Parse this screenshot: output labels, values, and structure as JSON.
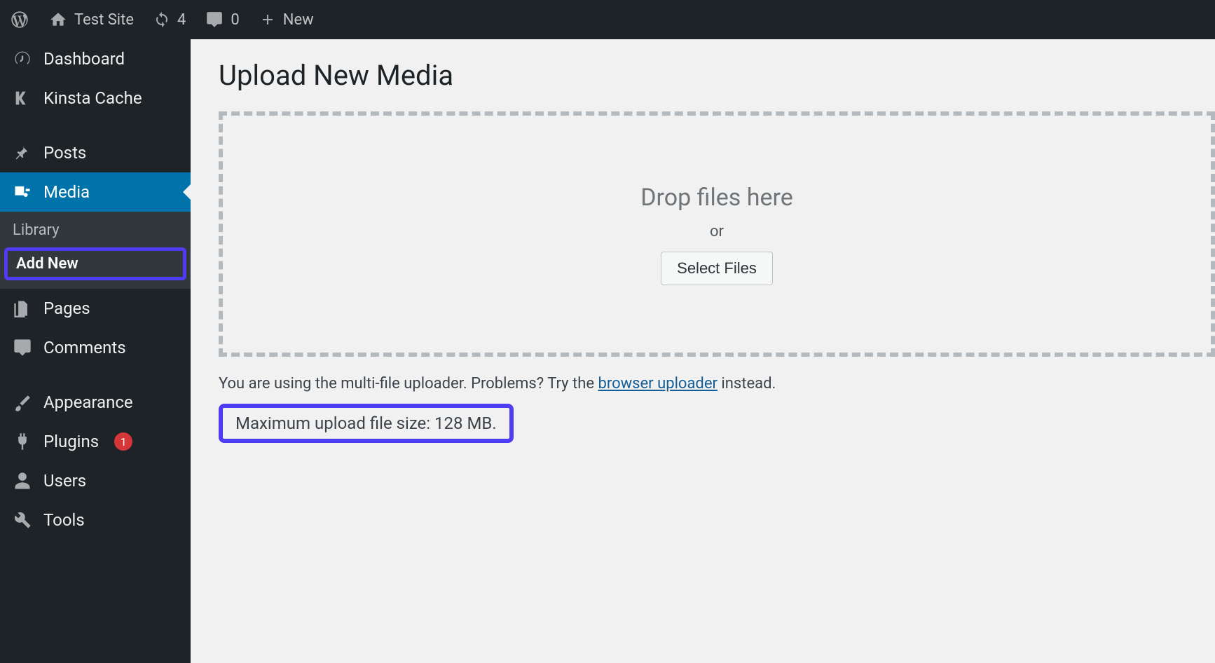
{
  "adminbar": {
    "site_name": "Test Site",
    "updates_count": "4",
    "comments_count": "0",
    "new_label": "New"
  },
  "sidebar": {
    "dashboard": "Dashboard",
    "kinsta": "Kinsta Cache",
    "posts": "Posts",
    "media": "Media",
    "submenu": {
      "library": "Library",
      "add_new": "Add New"
    },
    "pages": "Pages",
    "comments": "Comments",
    "appearance": "Appearance",
    "plugins": "Plugins",
    "plugins_count": "1",
    "users": "Users",
    "tools": "Tools"
  },
  "content": {
    "title": "Upload New Media",
    "drop_title": "Drop files here",
    "drop_or": "or",
    "select_btn": "Select Files",
    "note_prefix": "You are using the multi-file uploader. Problems? Try the ",
    "note_link": "browser uploader",
    "note_suffix": " instead.",
    "maxsize": "Maximum upload file size: 128 MB."
  }
}
